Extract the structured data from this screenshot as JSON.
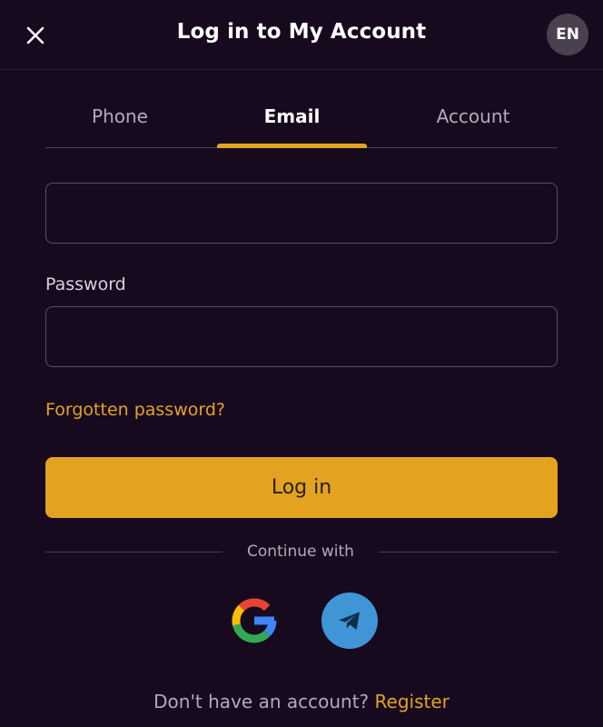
{
  "header": {
    "title": "Log in to My Account",
    "close_icon": "close-icon",
    "language": "EN"
  },
  "tabs": [
    {
      "label": "Phone",
      "active": false
    },
    {
      "label": "Email",
      "active": true
    },
    {
      "label": "Account",
      "active": false
    }
  ],
  "form": {
    "email_value": "",
    "email_placeholder": "",
    "password_label": "Password",
    "password_value": "",
    "password_placeholder": "",
    "forgot_label": "Forgotten password?",
    "login_label": "Log in"
  },
  "social": {
    "continue_text": "Continue with",
    "providers": [
      {
        "name": "Google",
        "icon": "google-icon"
      },
      {
        "name": "Telegram",
        "icon": "telegram-icon"
      }
    ]
  },
  "footer": {
    "prompt": "Don't have an account?",
    "register_label": "Register"
  },
  "colors": {
    "background": "#170a1f",
    "accent": "#e3a321",
    "telegram": "#3f95d6",
    "muted_text": "#b3aab8"
  }
}
